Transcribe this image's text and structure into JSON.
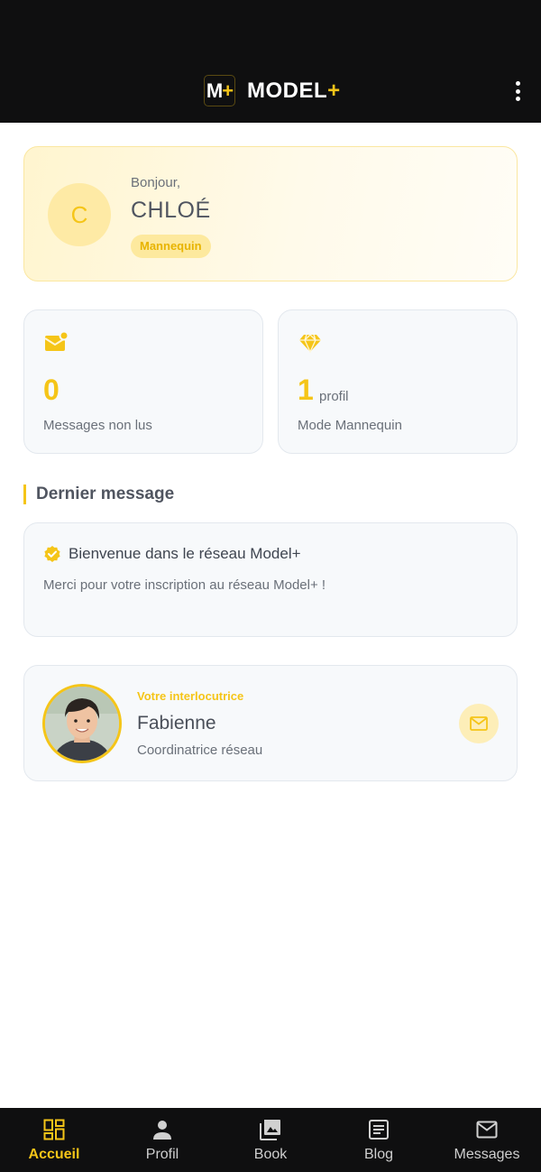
{
  "header": {
    "logo_badge_letter": "M",
    "logo_badge_plus": "+",
    "brand_text": "MODEL",
    "brand_plus": "+",
    "menu_icon": "more-vertical-icon"
  },
  "greeting": {
    "avatar_initial": "C",
    "hello": "Bonjour,",
    "name": "CHLOÉ",
    "role_badge": "Mannequin"
  },
  "stats": [
    {
      "icon": "mail-notification-icon",
      "value": "0",
      "suffix": "",
      "label": "Messages non lus"
    },
    {
      "icon": "diamond-icon",
      "value": "1",
      "suffix": "profil",
      "label": "Mode Mannequin"
    }
  ],
  "last_message": {
    "section_title": "Dernier message",
    "icon": "verified-badge-icon",
    "title": "Bienvenue dans le réseau Model+",
    "body": "Merci pour votre inscription au réseau Model+ !"
  },
  "contact": {
    "role": "Votre interlocutrice",
    "name": "Fabienne",
    "title": "Coordinatrice réseau",
    "action_icon": "mail-icon"
  },
  "bottom_nav": [
    {
      "label": "Accueil",
      "icon": "dashboard-icon",
      "active": true
    },
    {
      "label": "Profil",
      "icon": "person-icon",
      "active": false
    },
    {
      "label": "Book",
      "icon": "photo-library-icon",
      "active": false
    },
    {
      "label": "Blog",
      "icon": "article-icon",
      "active": false
    },
    {
      "label": "Messages",
      "icon": "mail-icon",
      "active": false
    }
  ],
  "colors": {
    "accent": "#f5c518",
    "bar_background": "#0f0f10",
    "card_background": "#f7f9fb"
  }
}
